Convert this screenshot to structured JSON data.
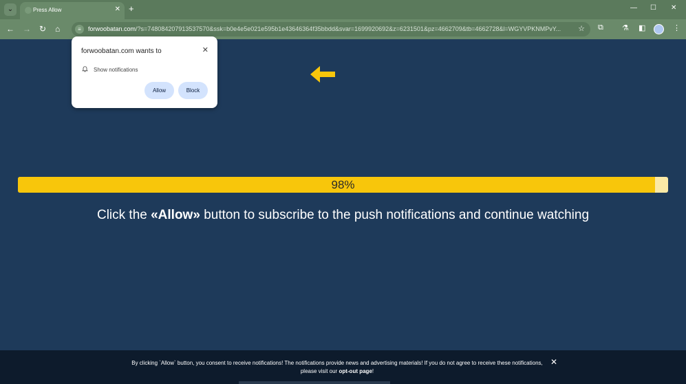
{
  "window": {
    "tab_title": "Press Allow",
    "tab_list_label": "⌄",
    "new_tab_label": "+",
    "minimize_label": "—",
    "maximize_label": "☐",
    "close_label": "✕"
  },
  "toolbar": {
    "url_domain": "forwoobatan.com",
    "url_rest": "/?s=748084207913537570&ssk=b0e4e5e021e595b1e43646364f35bbdd&svar=1699920692&z=6231501&pz=4662709&tb=4662728&l=WGYVPKNMPvY..."
  },
  "permission_prompt": {
    "title": "forwoobatan.com wants to",
    "permission": "Show notifications",
    "allow_label": "Allow",
    "block_label": "Block",
    "close_label": "✕"
  },
  "progress": {
    "value": 0.98,
    "label": "98%"
  },
  "message": {
    "prefix": "Click the ",
    "emphasis": "«Allow»",
    "suffix": " button to subscribe to the push notifications and continue watching"
  },
  "consent_bar": {
    "line1": "By clicking `Allow` button, you consent to receive notifications! The notifications provide news and advertising materials! If you do not agree to receive these notifications,",
    "line2_prefix": "please visit our ",
    "optout_label": "opt-out page",
    "line2_suffix": "!",
    "close_label": "✕"
  },
  "colors": {
    "page_background": "#1e3a5a",
    "progress_fill": "#f8c60b",
    "progress_track": "#fbe9a6",
    "arrow": "#f8c60b",
    "button_bg": "#d3e3fd"
  }
}
